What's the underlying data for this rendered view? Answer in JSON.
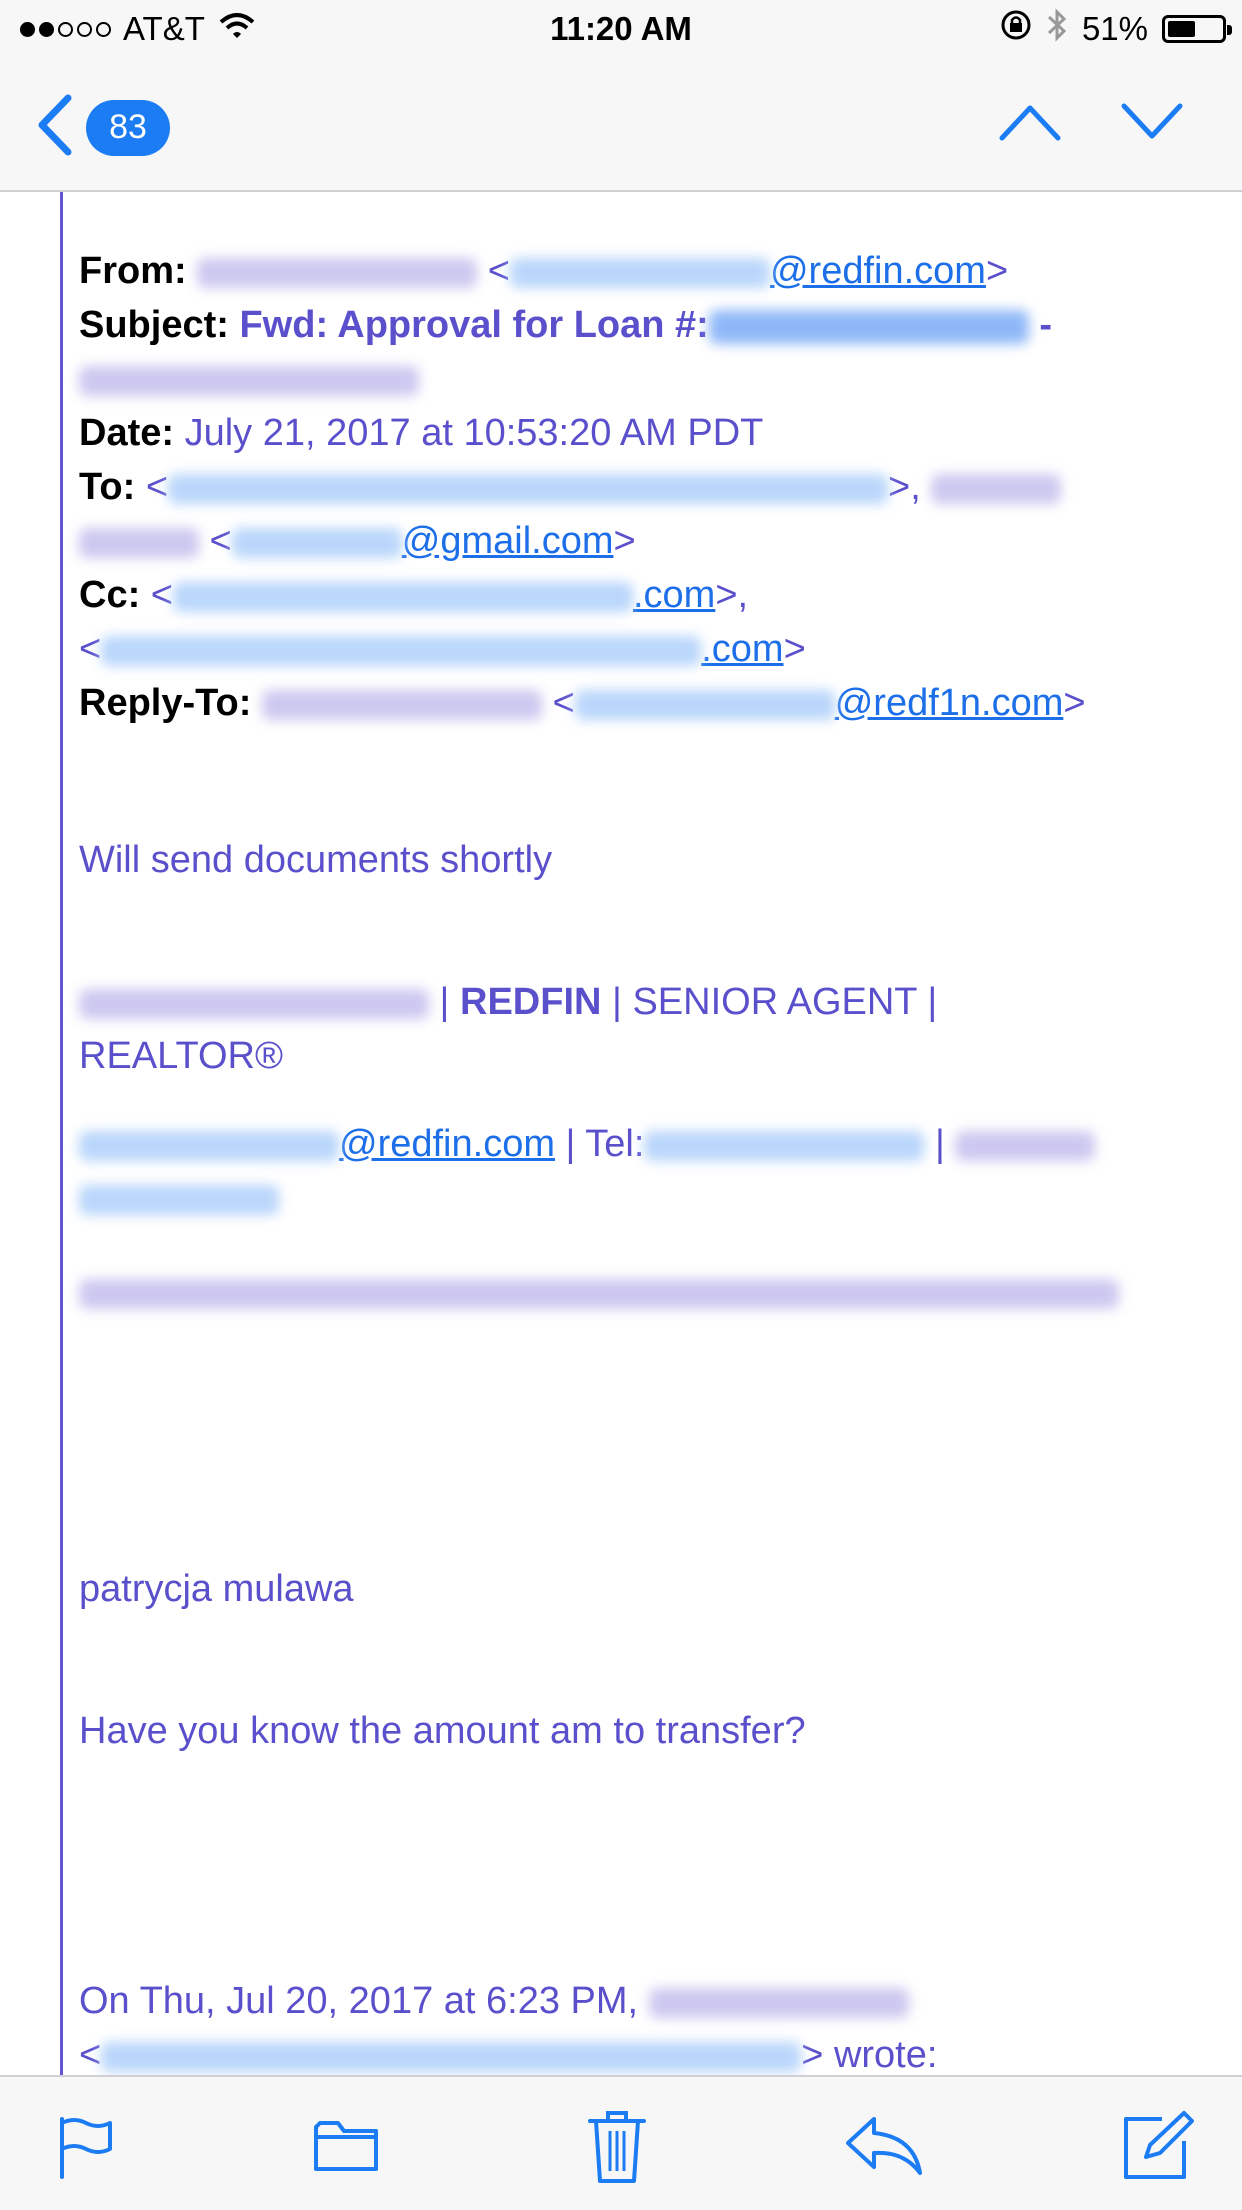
{
  "status_bar": {
    "carrier": "AT&T",
    "time": "11:20 AM",
    "battery_percent": "51%",
    "battery_level": 0.51,
    "signal_bars": 2,
    "icons": [
      "wifi-icon",
      "orientation-lock-icon",
      "bluetooth-icon",
      "battery-icon"
    ]
  },
  "nav": {
    "unread_count": "83",
    "icons": [
      "back-chevron-icon",
      "previous-message-icon",
      "next-message-icon"
    ]
  },
  "header": {
    "from_label": "From:",
    "from_domain": "@redfin.com",
    "subject_label": "Subject:",
    "subject_text": "Fwd: Approval for Loan #:",
    "subject_dash": "-",
    "date_label": "Date:",
    "date_value": "July 21, 2017 at 10:53:20 AM PDT",
    "to_label": "To:",
    "to_domain_2": "@gmail.com",
    "cc_label": "Cc:",
    "cc_domain_1": ".com",
    "cc_domain_2": ".com",
    "replyto_label": "Reply-To:",
    "replyto_domain": "@redf1n.com"
  },
  "body": {
    "line1": "Will send documents shortly",
    "sig_company": "REDFIN",
    "sig_title": "SENIOR AGENT",
    "sig_realtor": "REALTOR®",
    "sig_email_domain": "@redfin.com",
    "sig_tel_label": "Tel:",
    "sender_name": "patrycja mulawa",
    "question": "Have you know the amount am to transfer?",
    "quote_intro": "On Thu, Jul 20, 2017 at 6:23 PM,",
    "quote_wrote": "wrote:"
  },
  "toolbar": {
    "icons": [
      "flag-icon",
      "folder-icon",
      "trash-icon",
      "reply-icon",
      "compose-icon"
    ]
  },
  "colors": {
    "accent": "#1c7cf4",
    "quoted_text": "#5b50cc",
    "link": "#1c6fe8",
    "bars": "#f7f7f7"
  }
}
